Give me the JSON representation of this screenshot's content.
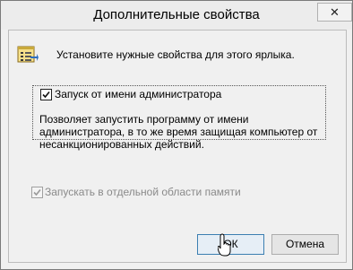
{
  "window": {
    "title": "Дополнительные свойства",
    "close_glyph": "✕"
  },
  "header": {
    "icon": "shortcut-properties-icon",
    "text": "Установите нужные свойства для этого ярлыка."
  },
  "options": [
    {
      "label": "Запуск от имени администратора",
      "checked": true,
      "enabled": true,
      "description": "Позволяет запустить программу от имени администратора, в то же время защищая компьютер от несанкционированных действий."
    },
    {
      "label": "Запускать в отдельной области памяти",
      "checked": true,
      "enabled": false
    }
  ],
  "buttons": {
    "ok": "ОК",
    "cancel": "Отмена"
  },
  "colors": {
    "accent": "#3c7fb1",
    "disabled_text": "#8a8a8a"
  }
}
